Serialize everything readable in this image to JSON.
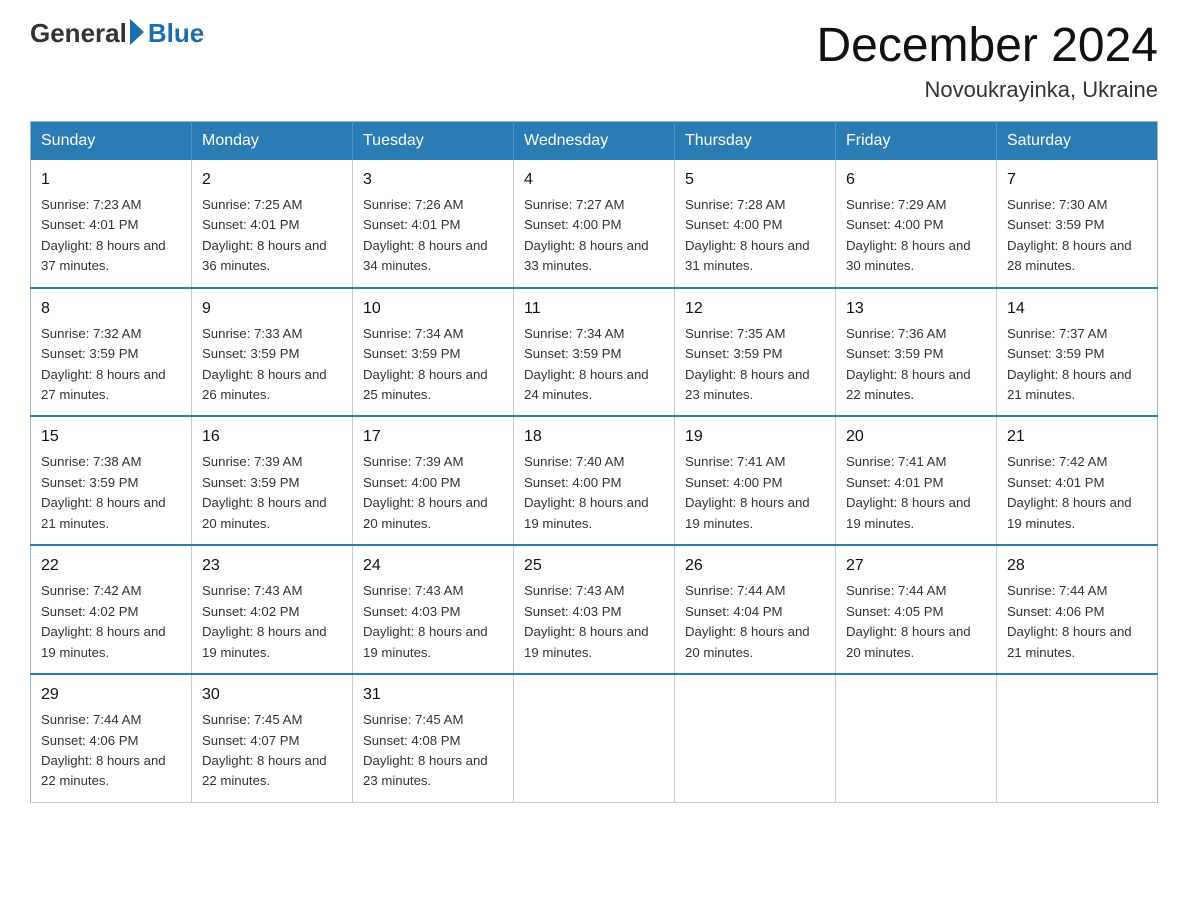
{
  "logo": {
    "general": "General",
    "blue": "Blue"
  },
  "title": {
    "month_year": "December 2024",
    "location": "Novoukrayinka, Ukraine"
  },
  "days_of_week": [
    "Sunday",
    "Monday",
    "Tuesday",
    "Wednesday",
    "Thursday",
    "Friday",
    "Saturday"
  ],
  "weeks": [
    [
      {
        "day": "1",
        "sunrise": "7:23 AM",
        "sunset": "4:01 PM",
        "daylight": "8 hours and 37 minutes."
      },
      {
        "day": "2",
        "sunrise": "7:25 AM",
        "sunset": "4:01 PM",
        "daylight": "8 hours and 36 minutes."
      },
      {
        "day": "3",
        "sunrise": "7:26 AM",
        "sunset": "4:01 PM",
        "daylight": "8 hours and 34 minutes."
      },
      {
        "day": "4",
        "sunrise": "7:27 AM",
        "sunset": "4:00 PM",
        "daylight": "8 hours and 33 minutes."
      },
      {
        "day": "5",
        "sunrise": "7:28 AM",
        "sunset": "4:00 PM",
        "daylight": "8 hours and 31 minutes."
      },
      {
        "day": "6",
        "sunrise": "7:29 AM",
        "sunset": "4:00 PM",
        "daylight": "8 hours and 30 minutes."
      },
      {
        "day": "7",
        "sunrise": "7:30 AM",
        "sunset": "3:59 PM",
        "daylight": "8 hours and 28 minutes."
      }
    ],
    [
      {
        "day": "8",
        "sunrise": "7:32 AM",
        "sunset": "3:59 PM",
        "daylight": "8 hours and 27 minutes."
      },
      {
        "day": "9",
        "sunrise": "7:33 AM",
        "sunset": "3:59 PM",
        "daylight": "8 hours and 26 minutes."
      },
      {
        "day": "10",
        "sunrise": "7:34 AM",
        "sunset": "3:59 PM",
        "daylight": "8 hours and 25 minutes."
      },
      {
        "day": "11",
        "sunrise": "7:34 AM",
        "sunset": "3:59 PM",
        "daylight": "8 hours and 24 minutes."
      },
      {
        "day": "12",
        "sunrise": "7:35 AM",
        "sunset": "3:59 PM",
        "daylight": "8 hours and 23 minutes."
      },
      {
        "day": "13",
        "sunrise": "7:36 AM",
        "sunset": "3:59 PM",
        "daylight": "8 hours and 22 minutes."
      },
      {
        "day": "14",
        "sunrise": "7:37 AM",
        "sunset": "3:59 PM",
        "daylight": "8 hours and 21 minutes."
      }
    ],
    [
      {
        "day": "15",
        "sunrise": "7:38 AM",
        "sunset": "3:59 PM",
        "daylight": "8 hours and 21 minutes."
      },
      {
        "day": "16",
        "sunrise": "7:39 AM",
        "sunset": "3:59 PM",
        "daylight": "8 hours and 20 minutes."
      },
      {
        "day": "17",
        "sunrise": "7:39 AM",
        "sunset": "4:00 PM",
        "daylight": "8 hours and 20 minutes."
      },
      {
        "day": "18",
        "sunrise": "7:40 AM",
        "sunset": "4:00 PM",
        "daylight": "8 hours and 19 minutes."
      },
      {
        "day": "19",
        "sunrise": "7:41 AM",
        "sunset": "4:00 PM",
        "daylight": "8 hours and 19 minutes."
      },
      {
        "day": "20",
        "sunrise": "7:41 AM",
        "sunset": "4:01 PM",
        "daylight": "8 hours and 19 minutes."
      },
      {
        "day": "21",
        "sunrise": "7:42 AM",
        "sunset": "4:01 PM",
        "daylight": "8 hours and 19 minutes."
      }
    ],
    [
      {
        "day": "22",
        "sunrise": "7:42 AM",
        "sunset": "4:02 PM",
        "daylight": "8 hours and 19 minutes."
      },
      {
        "day": "23",
        "sunrise": "7:43 AM",
        "sunset": "4:02 PM",
        "daylight": "8 hours and 19 minutes."
      },
      {
        "day": "24",
        "sunrise": "7:43 AM",
        "sunset": "4:03 PM",
        "daylight": "8 hours and 19 minutes."
      },
      {
        "day": "25",
        "sunrise": "7:43 AM",
        "sunset": "4:03 PM",
        "daylight": "8 hours and 19 minutes."
      },
      {
        "day": "26",
        "sunrise": "7:44 AM",
        "sunset": "4:04 PM",
        "daylight": "8 hours and 20 minutes."
      },
      {
        "day": "27",
        "sunrise": "7:44 AM",
        "sunset": "4:05 PM",
        "daylight": "8 hours and 20 minutes."
      },
      {
        "day": "28",
        "sunrise": "7:44 AM",
        "sunset": "4:06 PM",
        "daylight": "8 hours and 21 minutes."
      }
    ],
    [
      {
        "day": "29",
        "sunrise": "7:44 AM",
        "sunset": "4:06 PM",
        "daylight": "8 hours and 22 minutes."
      },
      {
        "day": "30",
        "sunrise": "7:45 AM",
        "sunset": "4:07 PM",
        "daylight": "8 hours and 22 minutes."
      },
      {
        "day": "31",
        "sunrise": "7:45 AM",
        "sunset": "4:08 PM",
        "daylight": "8 hours and 23 minutes."
      },
      null,
      null,
      null,
      null
    ]
  ]
}
